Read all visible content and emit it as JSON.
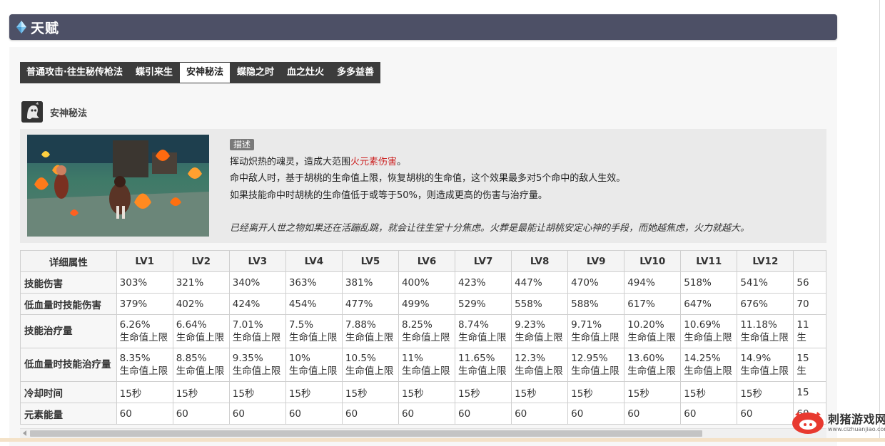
{
  "section": {
    "title": "天赋"
  },
  "tabs": [
    {
      "label": "普通攻击·往生秘传枪法",
      "active": false
    },
    {
      "label": "蝶引来生",
      "active": false
    },
    {
      "label": "安神秘法",
      "active": true
    },
    {
      "label": "蝶隐之时",
      "active": false
    },
    {
      "label": "血之灶火",
      "active": false
    },
    {
      "label": "多多益善",
      "active": false
    }
  ],
  "skill": {
    "name": "安神秘法",
    "badge": "描述",
    "line1_pre": "挥动炽热的魂灵，造成大范围",
    "line1_fire": "火元素伤害",
    "line1_post": "。",
    "line2": "命中敌人时，基于胡桃的生命值上限，恢复胡桃的生命值，这个效果最多对5个命中的敌人生效。",
    "line3": "如果技能命中时胡桃的生命值低于或等于50%，则造成更高的伤害与治疗量。",
    "quote": "已经离开人世之物如果还在活蹦乱跳，就会让往生堂十分焦虑。火葬是最能让胡桃安定心神的手段，而她越焦虑，火力就越大。"
  },
  "table": {
    "header": [
      "详细属性",
      "LV1",
      "LV2",
      "LV3",
      "LV4",
      "LV5",
      "LV6",
      "LV7",
      "LV8",
      "LV9",
      "LV10",
      "LV11",
      "LV12",
      ""
    ],
    "rows": [
      {
        "label": "技能伤害",
        "cells": [
          "303%",
          "321%",
          "340%",
          "363%",
          "381%",
          "400%",
          "423%",
          "447%",
          "470%",
          "494%",
          "518%",
          "541%",
          "56"
        ]
      },
      {
        "label": "低血量时技能伤害",
        "cells": [
          "379%",
          "402%",
          "424%",
          "454%",
          "477%",
          "499%",
          "529%",
          "558%",
          "588%",
          "617%",
          "647%",
          "676%",
          "70"
        ]
      },
      {
        "label": "技能治疗量",
        "cells": [
          "6.26%",
          "6.64%",
          "7.01%",
          "7.5%",
          "7.88%",
          "8.25%",
          "8.74%",
          "9.23%",
          "9.71%",
          "10.20%",
          "10.69%",
          "11.18%",
          "11"
        ],
        "sub": "生命值上限",
        "tall": true
      },
      {
        "label": "低血量时技能治疗量",
        "cells": [
          "8.35%",
          "8.85%",
          "9.35%",
          "10%",
          "10.5%",
          "11%",
          "11.65%",
          "12.3%",
          "12.95%",
          "13.60%",
          "14.25%",
          "14.9%",
          "15"
        ],
        "sub": "生命值上限",
        "tall": true
      },
      {
        "label": "冷却时间",
        "cells": [
          "15秒",
          "15秒",
          "15秒",
          "15秒",
          "15秒",
          "15秒",
          "15秒",
          "15秒",
          "15秒",
          "15秒",
          "15秒",
          "15秒",
          "15"
        ]
      },
      {
        "label": "元素能量",
        "cells": [
          "60",
          "60",
          "60",
          "60",
          "60",
          "60",
          "60",
          "60",
          "60",
          "60",
          "60",
          "60",
          "60"
        ]
      }
    ]
  },
  "watermark": {
    "name": "刺猪游戏网",
    "url": "www.cizhuanjiao.com"
  },
  "colors": {
    "header_bg": "#4d5066",
    "tab_bar": "#3c3c3c",
    "fire_text": "#cc2222",
    "logo_red": "#e8392f"
  },
  "icons": {
    "header": "diamond-icon",
    "skill": "ghost-icon",
    "watermark": "pig-logo-icon"
  }
}
